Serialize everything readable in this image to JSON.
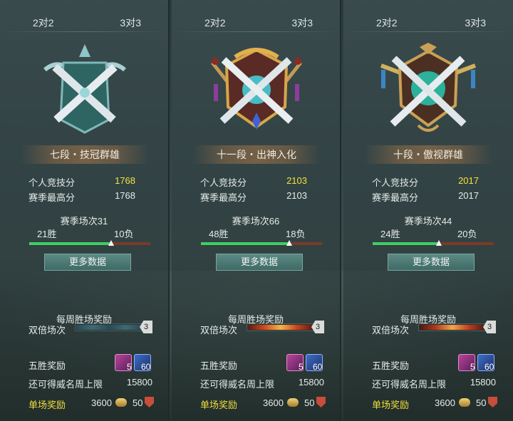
{
  "tabs": [
    "2对2",
    "3对3"
  ],
  "labels": {
    "personal_score": "个人竞技分",
    "season_high": "赛季最高分",
    "more_data": "更多数据",
    "weekly_reward": "每周胜场奖励",
    "double_matches": "双倍场次",
    "five_win_reward": "五胜奖励",
    "fame_limit": "还可得威名周上限",
    "single_reward": "单场奖励"
  },
  "panels": [
    {
      "rank": "十一段・出神入化",
      "score": "2103",
      "season_high": "2103",
      "season_matches": "赛季场次66",
      "wins": "48胜",
      "losses": "18负",
      "win_ratio": 0.727,
      "double_count": "3",
      "item1_count": "5",
      "item2_count": "60",
      "fame_limit": "15800",
      "single_a": "3600",
      "single_b": "50"
    },
    {
      "rank": "十段・傲视群雄",
      "score": "2017",
      "season_high": "2017",
      "season_matches": "赛季场次44",
      "wins": "24胜",
      "losses": "20负",
      "win_ratio": 0.545,
      "double_count": "3",
      "item1_count": "5",
      "item2_count": "60",
      "fame_limit": "15800",
      "single_a": "3600",
      "single_b": "50"
    },
    {
      "rank": "七段・技冠群雄",
      "score": "1768",
      "season_high": "1768",
      "season_matches": "赛季场次31",
      "wins": "21胜",
      "losses": "10负",
      "win_ratio": 0.677,
      "double_count": "3",
      "item1_count": "5",
      "item2_count": "60",
      "fame_limit": "15800",
      "single_a": "3600",
      "single_b": "50"
    }
  ],
  "colors": {
    "highlight": "#f1e23f",
    "win_bar": "#3fcf64",
    "loss_bar": "#7a3a2a",
    "single_reward_label": "#f0de3d"
  },
  "icons": [
    "crossed-swords-emblem-icon",
    "reward-scroll-icon",
    "reward-blade-icon",
    "coin-icon",
    "shield-icon"
  ]
}
